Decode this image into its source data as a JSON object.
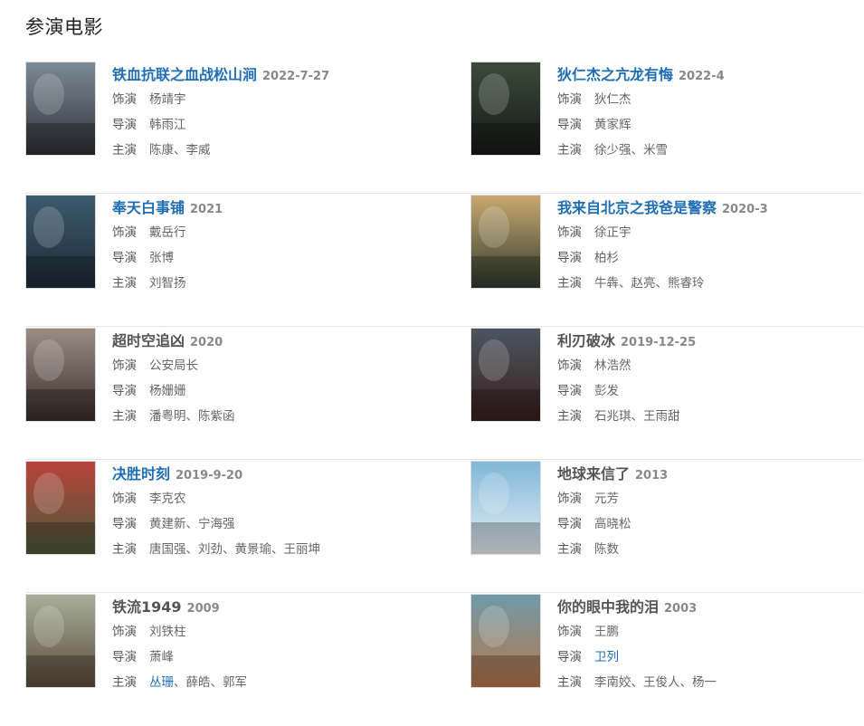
{
  "section_title": "参演电影",
  "labels": {
    "role": "饰演",
    "director": "导演",
    "cast": "主演"
  },
  "colors": {
    "link": "#1f6db5",
    "text": "#666666",
    "divider": "#e6e6e6"
  },
  "movies": [
    {
      "title": "铁血抗联之血战松山涧",
      "date": "2022-7-27",
      "title_link": true,
      "poster": {
        "top": "#7b8a95",
        "bottom": "#2e3236"
      },
      "role": [
        {
          "name": "杨靖宇",
          "link": false
        }
      ],
      "director": [
        {
          "name": "韩雨江",
          "link": false
        }
      ],
      "cast": [
        {
          "name": "陈康",
          "link": false
        },
        {
          "name": "李威",
          "link": false
        }
      ]
    },
    {
      "title": "狄仁杰之亢龙有悔",
      "date": "2022-4",
      "title_link": true,
      "poster": {
        "top": "#3b4a3a",
        "bottom": "#151a16"
      },
      "role": [
        {
          "name": "狄仁杰",
          "link": false
        }
      ],
      "director": [
        {
          "name": "黄家辉",
          "link": false
        }
      ],
      "cast": [
        {
          "name": "徐少强",
          "link": false
        },
        {
          "name": "米雪",
          "link": false
        }
      ]
    },
    {
      "title": "奉天白事铺",
      "date": "2021",
      "title_link": true,
      "poster": {
        "top": "#3c5a6e",
        "bottom": "#1c2a35"
      },
      "role": [
        {
          "name": "戴岳行",
          "link": false
        }
      ],
      "director": [
        {
          "name": "张博",
          "link": false
        }
      ],
      "cast": [
        {
          "name": "刘智扬",
          "link": false
        }
      ]
    },
    {
      "title": "我来自北京之我爸是警察",
      "date": "2020-3",
      "title_link": true,
      "poster": {
        "top": "#c9a970",
        "bottom": "#2f3a2c"
      },
      "role": [
        {
          "name": "徐正宇",
          "link": false
        }
      ],
      "director": [
        {
          "name": "柏杉",
          "link": false
        }
      ],
      "cast": [
        {
          "name": "牛犇",
          "link": false
        },
        {
          "name": "赵亮",
          "link": false
        },
        {
          "name": "熊睿玲",
          "link": false
        }
      ]
    },
    {
      "title": "超时空追凶",
      "date": "2020",
      "title_link": false,
      "poster": {
        "top": "#9a8d84",
        "bottom": "#3a2e2c"
      },
      "role": [
        {
          "name": "公安局长",
          "link": false
        }
      ],
      "director": [
        {
          "name": "杨姗姗",
          "link": false
        }
      ],
      "cast": [
        {
          "name": "潘粤明",
          "link": false
        },
        {
          "name": "陈紫函",
          "link": false
        }
      ]
    },
    {
      "title": "利刃破冰",
      "date": "2019-12-25",
      "title_link": false,
      "poster": {
        "top": "#4a5560",
        "bottom": "#3a1e1a"
      },
      "role": [
        {
          "name": "林浩然",
          "link": false
        }
      ],
      "director": [
        {
          "name": "彭发",
          "link": false
        }
      ],
      "cast": [
        {
          "name": "石兆琪",
          "link": false
        },
        {
          "name": "王雨甜",
          "link": false
        }
      ]
    },
    {
      "title": "决胜时刻",
      "date": "2019-9-20",
      "title_link": true,
      "poster": {
        "top": "#b8433a",
        "bottom": "#4a5a3a"
      },
      "role": [
        {
          "name": "李克农",
          "link": false
        }
      ],
      "director": [
        {
          "name": "黄建新",
          "link": false
        },
        {
          "name": "宁海强",
          "link": false
        }
      ],
      "cast": [
        {
          "name": "唐国强",
          "link": false
        },
        {
          "name": "刘劲",
          "link": false
        },
        {
          "name": "黄景瑜",
          "link": false
        },
        {
          "name": "王丽坤",
          "link": false
        }
      ]
    },
    {
      "title": "地球来信了",
      "date": "2013",
      "title_link": false,
      "poster": {
        "top": "#7fb7d8",
        "bottom": "#e8eef3"
      },
      "role": [
        {
          "name": "元芳",
          "link": false
        }
      ],
      "director": [
        {
          "name": "高晓松",
          "link": false
        }
      ],
      "cast": [
        {
          "name": "陈数",
          "link": false
        }
      ]
    },
    {
      "title": "铁流1949",
      "date": "2009",
      "title_link": false,
      "poster": {
        "top": "#a8ae9a",
        "bottom": "#5a4a3a"
      },
      "role": [
        {
          "name": "刘铁柱",
          "link": false
        }
      ],
      "director": [
        {
          "name": "萧峰",
          "link": false
        }
      ],
      "cast": [
        {
          "name": "丛珊",
          "link": true
        },
        {
          "name": "薛皓",
          "link": false
        },
        {
          "name": "郭军",
          "link": false
        }
      ]
    },
    {
      "title": "你的眼中我的泪",
      "date": "2003",
      "title_link": false,
      "poster": {
        "top": "#6f9aa8",
        "bottom": "#b8764a"
      },
      "role": [
        {
          "name": "王鹏",
          "link": false
        }
      ],
      "director": [
        {
          "name": "卫列",
          "link": true
        }
      ],
      "cast": [
        {
          "name": "李南姣",
          "link": false
        },
        {
          "name": "王俊人",
          "link": false
        },
        {
          "name": "杨一",
          "link": false
        }
      ]
    }
  ]
}
